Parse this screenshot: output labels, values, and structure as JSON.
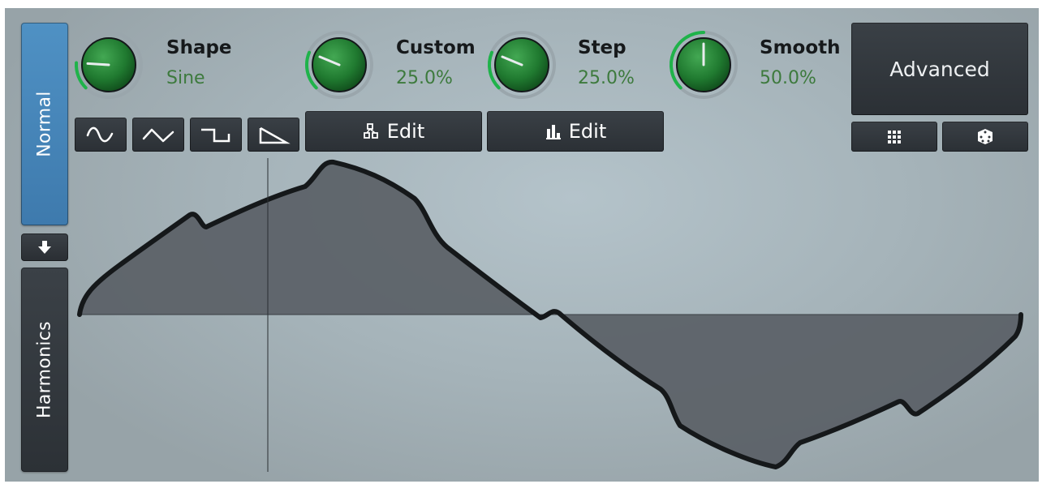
{
  "tabs": {
    "normal_label": "Normal",
    "harmonics_label": "Harmonics",
    "active": "Normal"
  },
  "params": {
    "shape": {
      "name": "Shape",
      "value": "Sine",
      "level": 0.18
    },
    "custom": {
      "name": "Custom",
      "value": "25.0%",
      "level": 0.25
    },
    "step": {
      "name": "Step",
      "value": "25.0%",
      "level": 0.25
    },
    "smooth": {
      "name": "Smooth",
      "value": "50.0%",
      "level": 0.5
    }
  },
  "buttons": {
    "edit_custom_label": "Edit",
    "edit_step_label": "Edit",
    "advanced_label": "Advanced"
  },
  "icons": {
    "wave_buttons": [
      "sine-wave-icon",
      "triangle-wave-icon",
      "square-wave-icon",
      "saw-wave-icon"
    ],
    "arrow": "arrow-down-icon",
    "custom_edit": "nodes-icon",
    "step_edit": "bars-icon",
    "grid": "grid-icon",
    "random": "dice-icon"
  },
  "colors": {
    "accent_blue": "#4a8bc0",
    "knob_green": "#2e8b3e",
    "arc_green": "#1fb34a",
    "value_green": "#3d7a3d",
    "button_dark": "#30353a"
  }
}
